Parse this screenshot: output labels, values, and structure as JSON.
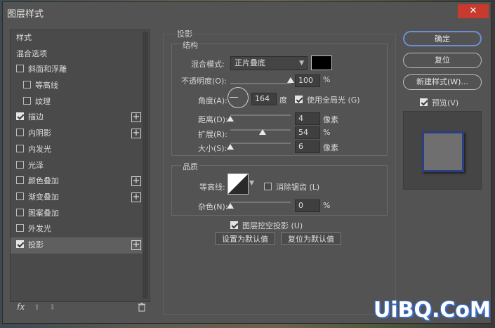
{
  "window": {
    "title": "图层样式",
    "close": "✕"
  },
  "left": {
    "items": [
      {
        "label": "样式",
        "checkbox": false,
        "checked": false,
        "indent": false,
        "plus": false,
        "selected": false
      },
      {
        "label": "混合选项",
        "checkbox": false,
        "checked": false,
        "indent": false,
        "plus": false,
        "selected": false
      },
      {
        "label": "斜面和浮雕",
        "checkbox": true,
        "checked": false,
        "indent": false,
        "plus": false,
        "selected": false
      },
      {
        "label": "等高线",
        "checkbox": true,
        "checked": false,
        "indent": true,
        "plus": false,
        "selected": false
      },
      {
        "label": "纹理",
        "checkbox": true,
        "checked": false,
        "indent": true,
        "plus": false,
        "selected": false
      },
      {
        "label": "描边",
        "checkbox": true,
        "checked": true,
        "indent": false,
        "plus": true,
        "selected": false
      },
      {
        "label": "内阴影",
        "checkbox": true,
        "checked": false,
        "indent": false,
        "plus": true,
        "selected": false
      },
      {
        "label": "内发光",
        "checkbox": true,
        "checked": false,
        "indent": false,
        "plus": false,
        "selected": false
      },
      {
        "label": "光泽",
        "checkbox": true,
        "checked": false,
        "indent": false,
        "plus": false,
        "selected": false
      },
      {
        "label": "颜色叠加",
        "checkbox": true,
        "checked": false,
        "indent": false,
        "plus": true,
        "selected": false
      },
      {
        "label": "渐变叠加",
        "checkbox": true,
        "checked": false,
        "indent": false,
        "plus": true,
        "selected": false
      },
      {
        "label": "图案叠加",
        "checkbox": true,
        "checked": false,
        "indent": false,
        "plus": false,
        "selected": false
      },
      {
        "label": "外发光",
        "checkbox": true,
        "checked": false,
        "indent": false,
        "plus": false,
        "selected": false
      },
      {
        "label": "投影",
        "checkbox": true,
        "checked": true,
        "indent": false,
        "plus": true,
        "selected": true
      }
    ],
    "bottom": {
      "fx": "fx",
      "up": "⬆",
      "down": "⬇",
      "trash": "🗑"
    }
  },
  "shadow": {
    "section_title": "投影",
    "structure_title": "结构",
    "blend_mode_label": "混合模式:",
    "blend_mode_value": "正片叠底",
    "shadow_color": "#000000",
    "opacity_label": "不透明度(O):",
    "opacity_value": "100",
    "opacity_unit": "%",
    "opacity_fraction": 1.0,
    "angle_label": "角度(A):",
    "angle_value": "164",
    "angle_unit": "度",
    "global_light_label": "使用全局光 (G)",
    "global_light_checked": true,
    "distance_label": "距离(D):",
    "distance_value": "4",
    "distance_unit": "像素",
    "distance_fraction": 0.0,
    "spread_label": "扩展(R):",
    "spread_value": "54",
    "spread_unit": "%",
    "spread_fraction": 0.54,
    "size_label": "大小(S):",
    "size_value": "6",
    "size_unit": "像素",
    "size_fraction": 0.0,
    "quality_title": "品质",
    "contour_label": "等高线:",
    "antialias_label": "消除锯齿 (L)",
    "antialias_checked": false,
    "noise_label": "杂色(N):",
    "noise_value": "0",
    "noise_unit": "%",
    "noise_fraction": 0.0,
    "knockout_label": "图层挖空投影 (U)",
    "knockout_checked": true,
    "set_default": "设置为默认值",
    "reset_default": "复位为默认值"
  },
  "right": {
    "ok": "确定",
    "reset": "复位",
    "new_style": "新建样式(W)...",
    "preview_label": "预览(V)",
    "preview_checked": true
  },
  "watermark": "UiBQ.CoM"
}
